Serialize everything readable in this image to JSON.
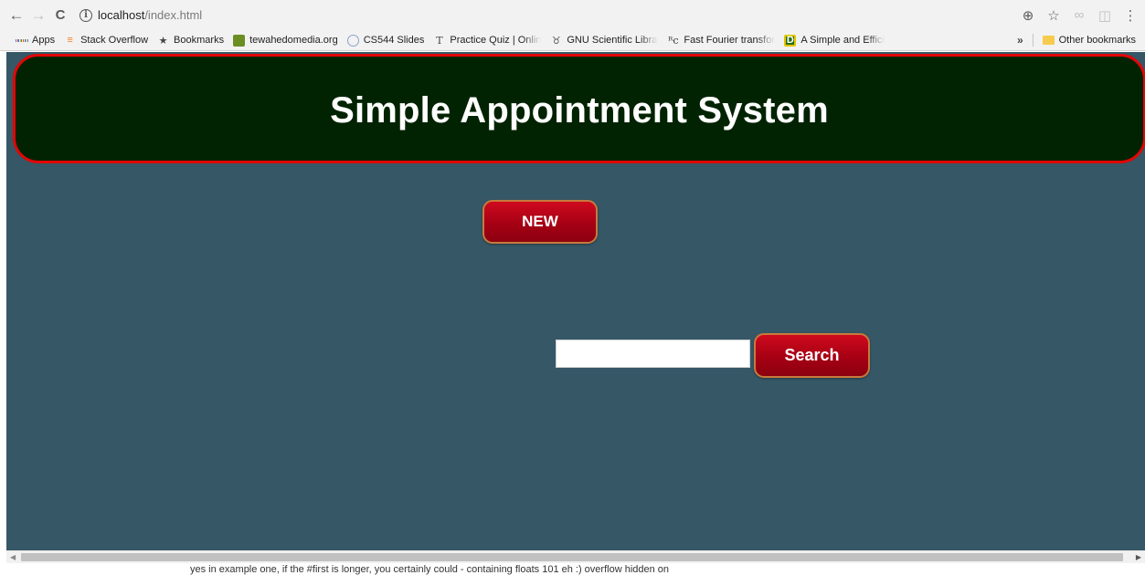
{
  "browser": {
    "url_host": "localhost",
    "url_path": "/index.html",
    "bookmarks": [
      {
        "label": "Apps",
        "icon": "apps-grid-icon"
      },
      {
        "label": "Stack Overflow",
        "icon": "stackoverflow-icon"
      },
      {
        "label": "Bookmarks",
        "icon": "star-icon"
      },
      {
        "label": "tewahedomedia.org",
        "icon": "site-favicon"
      },
      {
        "label": "CS544 Slides",
        "icon": "site-favicon"
      },
      {
        "label": "Practice Quiz | Online",
        "icon": "t-favicon"
      },
      {
        "label": "GNU Scientific Library",
        "icon": "gnu-favicon"
      },
      {
        "label": "Fast Fourier transform",
        "icon": "rc-favicon"
      },
      {
        "label": "A Simple and Efficient",
        "icon": "d-favicon"
      }
    ],
    "overflow_label": "»",
    "other_bookmarks": "Other bookmarks"
  },
  "page": {
    "title": "Simple Appointment System",
    "new_button": "NEW",
    "search_button": "Search",
    "search_value": ""
  },
  "background_text": "yes in example one, if the #first is longer, you certainly could - containing floats 101 eh :)   overflow hidden on",
  "colors": {
    "page_background": "#365766",
    "header_background": "#012301",
    "header_border": "#e10606",
    "button_red": "#b8001a"
  }
}
